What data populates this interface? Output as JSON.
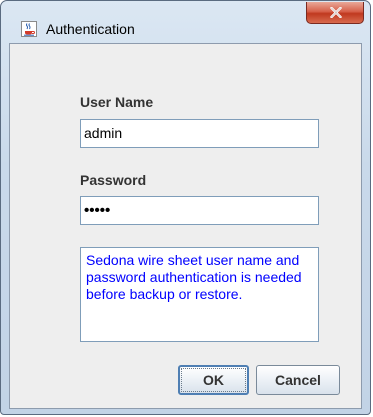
{
  "window": {
    "title": "Authentication",
    "icons": {
      "app": "java-cup-icon",
      "close": "close-x-icon"
    }
  },
  "form": {
    "username_label": "User Name",
    "username_value": "admin",
    "password_label": "Password",
    "password_mask": "•••••",
    "message": "Sedona wire sheet user name and password authentication is needed before backup or restore."
  },
  "buttons": {
    "ok_label": "OK",
    "cancel_label": "Cancel"
  },
  "colors": {
    "message_text": "#0000ff",
    "close_button": "#c0391f",
    "title_bar": "#c9d9ea"
  }
}
